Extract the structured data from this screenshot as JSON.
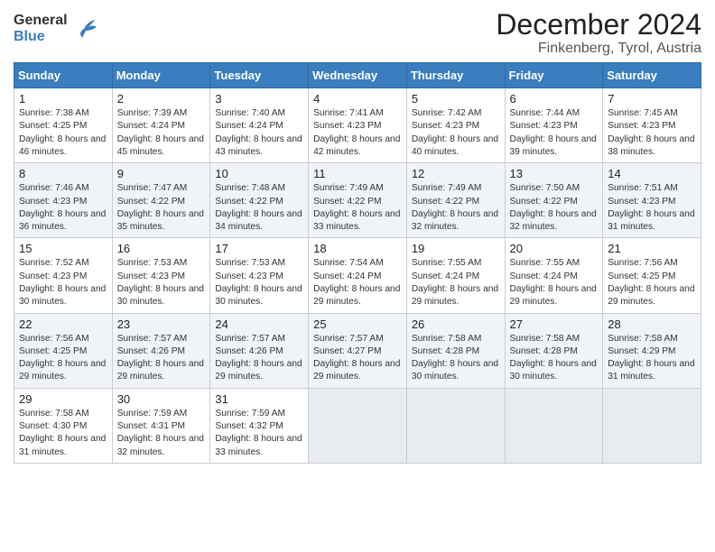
{
  "logo": {
    "line1": "General",
    "line2": "Blue"
  },
  "title": "December 2024",
  "subtitle": "Finkenberg, Tyrol, Austria",
  "weekdays": [
    "Sunday",
    "Monday",
    "Tuesday",
    "Wednesday",
    "Thursday",
    "Friday",
    "Saturday"
  ],
  "weeks": [
    [
      {
        "day": "1",
        "sunrise": "7:38 AM",
        "sunset": "4:25 PM",
        "daylight": "8 hours and 46 minutes."
      },
      {
        "day": "2",
        "sunrise": "7:39 AM",
        "sunset": "4:24 PM",
        "daylight": "8 hours and 45 minutes."
      },
      {
        "day": "3",
        "sunrise": "7:40 AM",
        "sunset": "4:24 PM",
        "daylight": "8 hours and 43 minutes."
      },
      {
        "day": "4",
        "sunrise": "7:41 AM",
        "sunset": "4:23 PM",
        "daylight": "8 hours and 42 minutes."
      },
      {
        "day": "5",
        "sunrise": "7:42 AM",
        "sunset": "4:23 PM",
        "daylight": "8 hours and 40 minutes."
      },
      {
        "day": "6",
        "sunrise": "7:44 AM",
        "sunset": "4:23 PM",
        "daylight": "8 hours and 39 minutes."
      },
      {
        "day": "7",
        "sunrise": "7:45 AM",
        "sunset": "4:23 PM",
        "daylight": "8 hours and 38 minutes."
      }
    ],
    [
      {
        "day": "8",
        "sunrise": "7:46 AM",
        "sunset": "4:23 PM",
        "daylight": "8 hours and 36 minutes."
      },
      {
        "day": "9",
        "sunrise": "7:47 AM",
        "sunset": "4:22 PM",
        "daylight": "8 hours and 35 minutes."
      },
      {
        "day": "10",
        "sunrise": "7:48 AM",
        "sunset": "4:22 PM",
        "daylight": "8 hours and 34 minutes."
      },
      {
        "day": "11",
        "sunrise": "7:49 AM",
        "sunset": "4:22 PM",
        "daylight": "8 hours and 33 minutes."
      },
      {
        "day": "12",
        "sunrise": "7:49 AM",
        "sunset": "4:22 PM",
        "daylight": "8 hours and 32 minutes."
      },
      {
        "day": "13",
        "sunrise": "7:50 AM",
        "sunset": "4:22 PM",
        "daylight": "8 hours and 32 minutes."
      },
      {
        "day": "14",
        "sunrise": "7:51 AM",
        "sunset": "4:23 PM",
        "daylight": "8 hours and 31 minutes."
      }
    ],
    [
      {
        "day": "15",
        "sunrise": "7:52 AM",
        "sunset": "4:23 PM",
        "daylight": "8 hours and 30 minutes."
      },
      {
        "day": "16",
        "sunrise": "7:53 AM",
        "sunset": "4:23 PM",
        "daylight": "8 hours and 30 minutes."
      },
      {
        "day": "17",
        "sunrise": "7:53 AM",
        "sunset": "4:23 PM",
        "daylight": "8 hours and 30 minutes."
      },
      {
        "day": "18",
        "sunrise": "7:54 AM",
        "sunset": "4:24 PM",
        "daylight": "8 hours and 29 minutes."
      },
      {
        "day": "19",
        "sunrise": "7:55 AM",
        "sunset": "4:24 PM",
        "daylight": "8 hours and 29 minutes."
      },
      {
        "day": "20",
        "sunrise": "7:55 AM",
        "sunset": "4:24 PM",
        "daylight": "8 hours and 29 minutes."
      },
      {
        "day": "21",
        "sunrise": "7:56 AM",
        "sunset": "4:25 PM",
        "daylight": "8 hours and 29 minutes."
      }
    ],
    [
      {
        "day": "22",
        "sunrise": "7:56 AM",
        "sunset": "4:25 PM",
        "daylight": "8 hours and 29 minutes."
      },
      {
        "day": "23",
        "sunrise": "7:57 AM",
        "sunset": "4:26 PM",
        "daylight": "8 hours and 29 minutes."
      },
      {
        "day": "24",
        "sunrise": "7:57 AM",
        "sunset": "4:26 PM",
        "daylight": "8 hours and 29 minutes."
      },
      {
        "day": "25",
        "sunrise": "7:57 AM",
        "sunset": "4:27 PM",
        "daylight": "8 hours and 29 minutes."
      },
      {
        "day": "26",
        "sunrise": "7:58 AM",
        "sunset": "4:28 PM",
        "daylight": "8 hours and 30 minutes."
      },
      {
        "day": "27",
        "sunrise": "7:58 AM",
        "sunset": "4:28 PM",
        "daylight": "8 hours and 30 minutes."
      },
      {
        "day": "28",
        "sunrise": "7:58 AM",
        "sunset": "4:29 PM",
        "daylight": "8 hours and 31 minutes."
      }
    ],
    [
      {
        "day": "29",
        "sunrise": "7:58 AM",
        "sunset": "4:30 PM",
        "daylight": "8 hours and 31 minutes."
      },
      {
        "day": "30",
        "sunrise": "7:59 AM",
        "sunset": "4:31 PM",
        "daylight": "8 hours and 32 minutes."
      },
      {
        "day": "31",
        "sunrise": "7:59 AM",
        "sunset": "4:32 PM",
        "daylight": "8 hours and 33 minutes."
      },
      null,
      null,
      null,
      null
    ]
  ]
}
